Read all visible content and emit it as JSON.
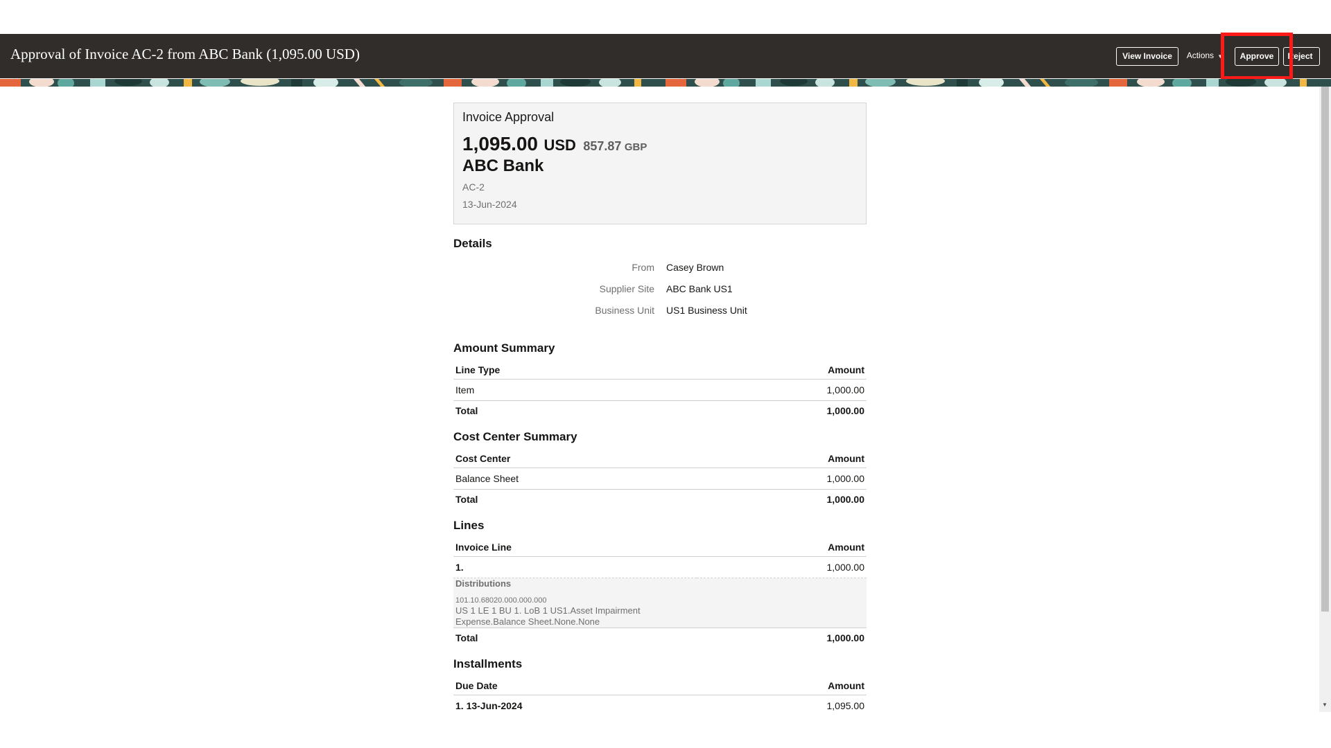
{
  "header": {
    "title": "Approval of Invoice AC-2 from ABC Bank (1,095.00 USD)",
    "view_invoice": "View Invoice",
    "actions": "Actions",
    "actions_icon": "chevron-down-icon",
    "approve": "Approve",
    "reject": "Reject",
    "highlight_color": "#ff1a1a"
  },
  "summary_card": {
    "title": "Invoice Approval",
    "amount": "1,095.00",
    "currency": "USD",
    "secondary_amount": "857.87",
    "secondary_currency": "GBP",
    "supplier": "ABC Bank",
    "invoice_number": "AC-2",
    "date": "13-Jun-2024"
  },
  "details": {
    "title": "Details",
    "rows": [
      {
        "label": "From",
        "value": "Casey Brown"
      },
      {
        "label": "Supplier Site",
        "value": "ABC Bank US1"
      },
      {
        "label": "Business Unit",
        "value": "US1 Business Unit"
      }
    ]
  },
  "amount_summary": {
    "title": "Amount Summary",
    "col1": "Line Type",
    "col2": "Amount",
    "rows": [
      {
        "name": "Item",
        "amount": "1,000.00"
      }
    ],
    "total_label": "Total",
    "total": "1,000.00"
  },
  "cost_center_summary": {
    "title": "Cost Center Summary",
    "col1": "Cost Center",
    "col2": "Amount",
    "rows": [
      {
        "name": "Balance Sheet",
        "amount": "1,000.00"
      }
    ],
    "total_label": "Total",
    "total": "1,000.00"
  },
  "lines": {
    "title": "Lines",
    "col1": "Invoice Line",
    "col2": "Amount",
    "line_number": "1.",
    "line_amount": "1,000.00",
    "distributions_label": "Distributions",
    "distribution_code": "101.10.68020.000.000.000",
    "distribution_desc_1": "US 1 LE 1 BU 1. LoB 1 US1.Asset Impairment",
    "distribution_desc_2": "Expense.Balance Sheet.None.None",
    "total_label": "Total",
    "total": "1,000.00"
  },
  "installments": {
    "title": "Installments",
    "col1": "Due Date",
    "col2": "Amount",
    "rows": [
      {
        "date": "1. 13-Jun-2024",
        "amount": "1,095.00"
      }
    ]
  }
}
